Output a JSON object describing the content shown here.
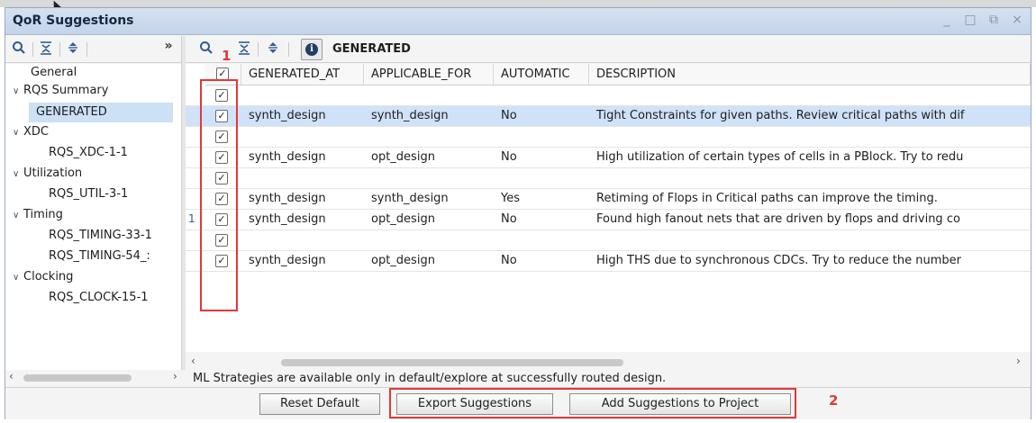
{
  "window": {
    "title": "QoR Suggestions",
    "controls": [
      "_",
      "□",
      "⧉",
      "×"
    ]
  },
  "left_toolbar": {
    "icons": [
      "search-icon",
      "collapse-all-icon",
      "expand-all-icon",
      "overflow-icon"
    ],
    "overflow_glyph": "»"
  },
  "right_toolbar": {
    "icons": [
      "search-icon",
      "collapse-all-icon",
      "expand-all-icon",
      "info-icon"
    ],
    "label": "GENERATED"
  },
  "tree": [
    {
      "label": "General",
      "indent": 0,
      "expandable": false
    },
    {
      "label": "RQS Summary",
      "indent": 0,
      "expandable": true
    },
    {
      "label": "GENERATED",
      "indent": 1,
      "selected": true
    },
    {
      "label": "XDC",
      "indent": 0,
      "expandable": true
    },
    {
      "label": "RQS_XDC-1-1",
      "indent": 1
    },
    {
      "label": "Utilization",
      "indent": 0,
      "expandable": true
    },
    {
      "label": "RQS_UTIL-3-1",
      "indent": 1
    },
    {
      "label": "Timing",
      "indent": 0,
      "expandable": true
    },
    {
      "label": "RQS_TIMING-33-1",
      "indent": 1
    },
    {
      "label": "RQS_TIMING-54_:",
      "indent": 1
    },
    {
      "label": "Clocking",
      "indent": 0,
      "expandable": true
    },
    {
      "label": "RQS_CLOCK-15-1",
      "indent": 1
    }
  ],
  "table": {
    "columns": [
      "GENERATED_AT",
      "APPLICABLE_FOR",
      "AUTOMATIC",
      "DESCRIPTION"
    ],
    "rows": [
      {
        "checked": true,
        "generated_at": "",
        "applicable_for": "",
        "automatic": "",
        "description": ""
      },
      {
        "checked": true,
        "generated_at": "synth_design",
        "applicable_for": "synth_design",
        "automatic": "No",
        "description": "Tight Constraints for given paths. Review critical paths with dif",
        "selected": true
      },
      {
        "checked": true,
        "generated_at": "",
        "applicable_for": "",
        "automatic": "",
        "description": ""
      },
      {
        "checked": true,
        "generated_at": "synth_design",
        "applicable_for": "opt_design",
        "automatic": "No",
        "description": "High utilization of certain types of cells in a PBlock. Try to redu"
      },
      {
        "checked": true,
        "generated_at": "",
        "applicable_for": "",
        "automatic": "",
        "description": ""
      },
      {
        "checked": true,
        "generated_at": "synth_design",
        "applicable_for": "synth_design",
        "automatic": "Yes",
        "description": "Retiming of Flops in Critical paths can improve the timing."
      },
      {
        "checked": true,
        "generated_at": "synth_design",
        "applicable_for": "opt_design",
        "automatic": "No",
        "description": "Found high fanout nets that are driven by flops and driving co"
      },
      {
        "checked": true,
        "generated_at": "",
        "applicable_for": "",
        "automatic": "",
        "description": ""
      },
      {
        "checked": true,
        "generated_at": "synth_design",
        "applicable_for": "opt_design",
        "automatic": "No",
        "description": "High THS due to synchronous CDCs. Try to reduce the number"
      }
    ],
    "row_marker": "1"
  },
  "message": "ML Strategies are available only in default/explore at successfully routed design.",
  "buttons": {
    "reset": "Reset Default",
    "export": "Export Suggestions",
    "add": "Add Suggestions to Project"
  },
  "annotations": {
    "marker_1": "1",
    "marker_2": "2",
    "color": "#e0383b"
  },
  "checkbox_glyph": "✓"
}
